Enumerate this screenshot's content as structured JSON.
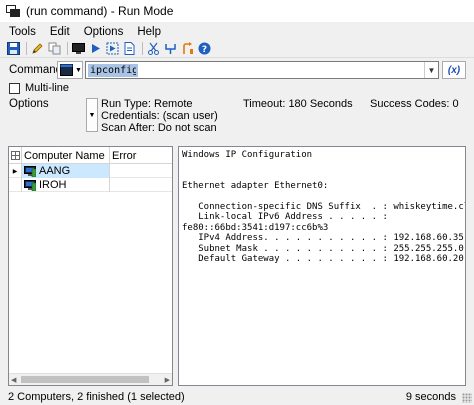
{
  "window": {
    "title": "(run command) - Run Mode"
  },
  "menu": [
    "Tools",
    "Edit",
    "Options",
    "Help"
  ],
  "toolbar": {
    "icons": [
      "save-icon",
      "edit-icon",
      "copy-config-icon",
      "console-icon",
      "run-icon",
      "run-selected-icon",
      "document-icon",
      "cut-icon",
      "merge-icon",
      "undo-icon",
      "help-icon"
    ],
    "colors": {
      "blue": "#1f5fbf",
      "yellow": "#e8b424",
      "orange": "#e07b10"
    }
  },
  "command": {
    "label": "Command",
    "value": "ipconfig",
    "variables_button": "(x)"
  },
  "multiline": {
    "label": "Multi-line",
    "checked": false
  },
  "options": {
    "label": "Options",
    "run_type": "Run Type: Remote",
    "credentials": "Credentials: (scan user)",
    "scan_after": "Scan After: Do not scan",
    "timeout": "Timeout: 180 Seconds",
    "success_codes": "Success Codes: 0"
  },
  "grid": {
    "columns": [
      "Computer Name",
      "Error"
    ],
    "rows": [
      {
        "name": "AANG",
        "error": "",
        "selected": true
      },
      {
        "name": "IROH",
        "error": "",
        "selected": false
      }
    ]
  },
  "output": {
    "text": "Windows IP Configuration\n\n\nEthernet adapter Ethernet0:\n\n   Connection-specific DNS Suffix  . : whiskeytime.club\n   Link-local IPv6 Address . . . . . :\nfe80::66bd:3541:d197:cc6b%3\n   IPv4 Address. . . . . . . . . . . : 192.168.60.35\n   Subnet Mask . . . . . . . . . . . : 255.255.255.0\n   Default Gateway . . . . . . . . . : 192.168.60.20"
  },
  "status": {
    "left": "2 Computers, 2 finished (1 selected)",
    "right": "9 seconds"
  }
}
